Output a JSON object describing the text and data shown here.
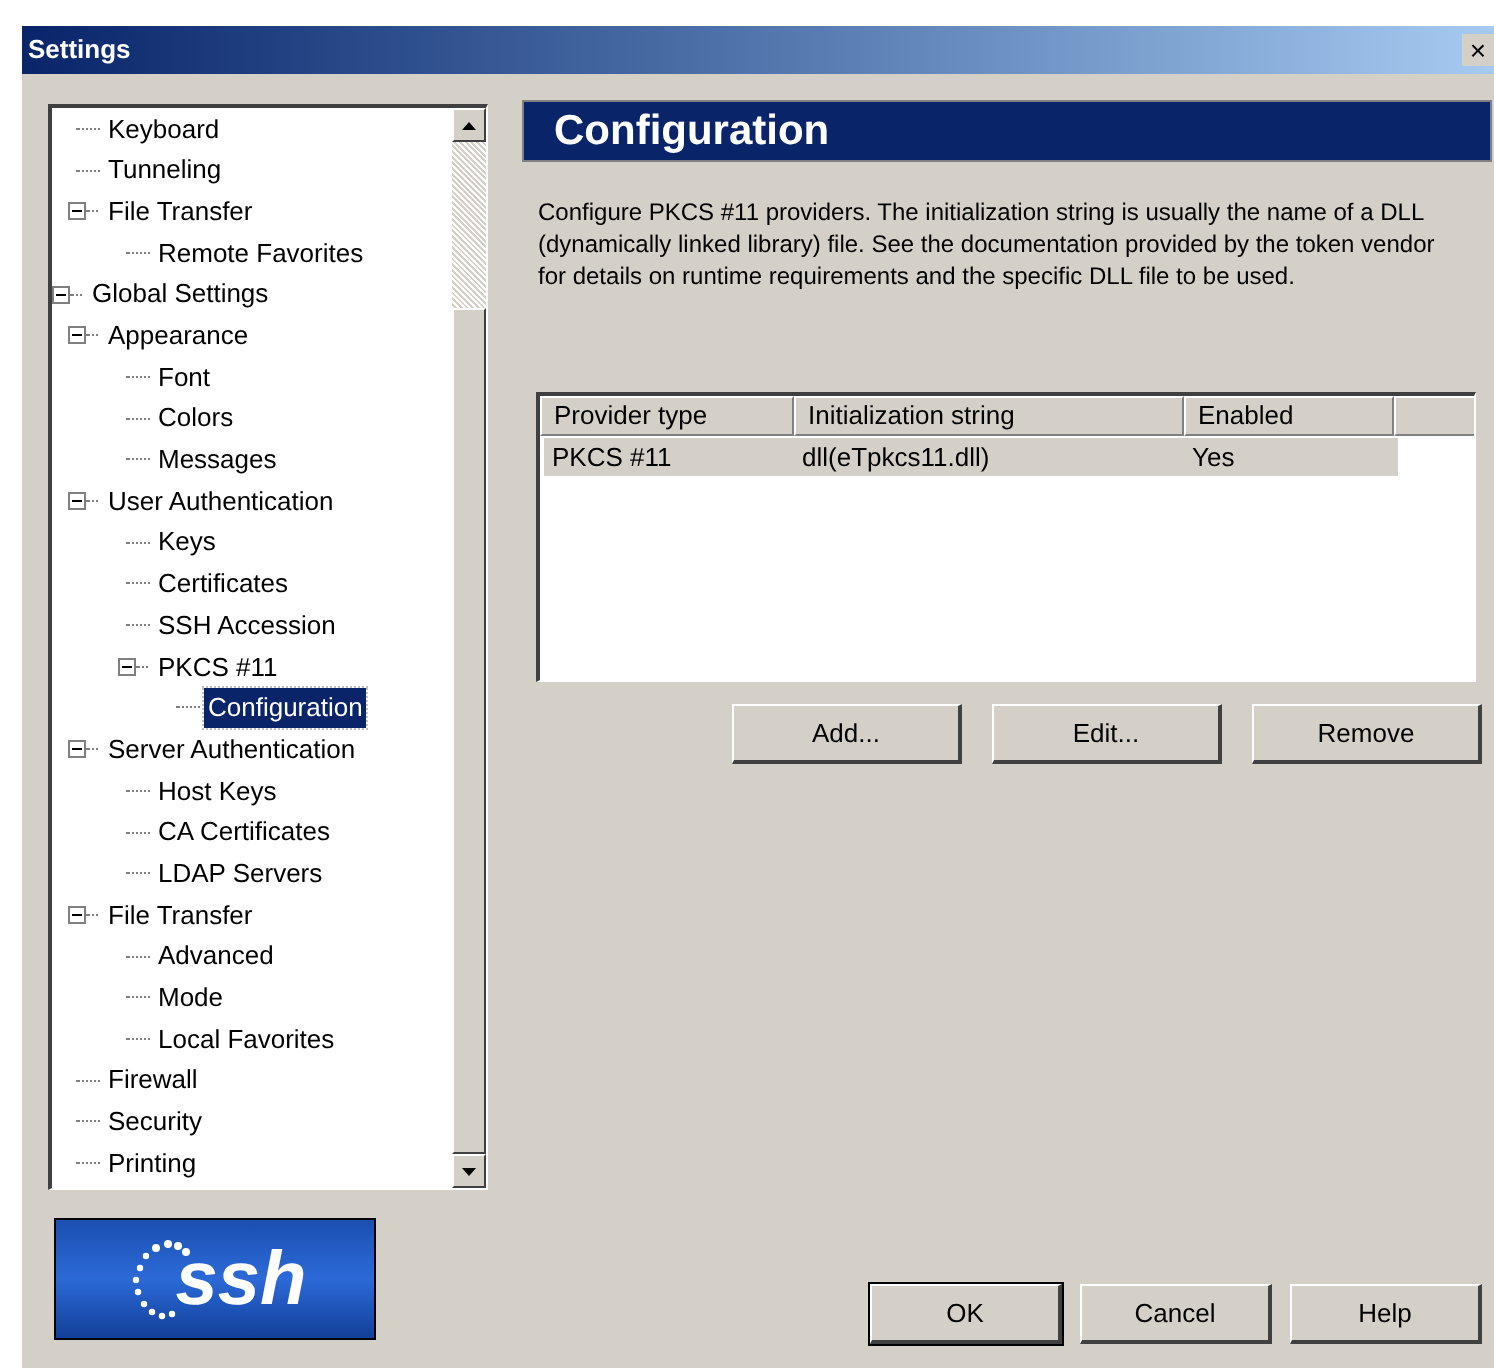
{
  "window": {
    "title": "Settings",
    "close": "×"
  },
  "tree": {
    "items": [
      {
        "children": [
          {
            "label": "Keyboard",
            "selected": false
          },
          {
            "label": "Tunneling",
            "selected": false
          },
          {
            "label": "File Transfer",
            "selected": false,
            "expanded": true,
            "children": [
              {
                "label": "Remote Favorites",
                "selected": false
              }
            ]
          }
        ]
      },
      {
        "label": "Global Settings",
        "selected": false,
        "expanded": true,
        "children": [
          {
            "label": "Appearance",
            "selected": false,
            "expanded": true,
            "children": [
              {
                "label": "Font",
                "selected": false
              },
              {
                "label": "Colors",
                "selected": false
              },
              {
                "label": "Messages",
                "selected": false
              }
            ]
          },
          {
            "label": "User Authentication",
            "selected": false,
            "expanded": true,
            "children": [
              {
                "label": "Keys",
                "selected": false
              },
              {
                "label": "Certificates",
                "selected": false
              },
              {
                "label": "SSH Accession",
                "selected": false
              },
              {
                "label": "PKCS #11",
                "selected": false,
                "expanded": true,
                "children": [
                  {
                    "label": "Configuration",
                    "selected": true
                  }
                ]
              }
            ]
          },
          {
            "label": "Server Authentication",
            "selected": false,
            "expanded": true,
            "children": [
              {
                "label": "Host Keys",
                "selected": false
              },
              {
                "label": "CA Certificates",
                "selected": false
              },
              {
                "label": "LDAP Servers",
                "selected": false
              }
            ]
          },
          {
            "label": "File Transfer",
            "selected": false,
            "expanded": true,
            "children": [
              {
                "label": "Advanced",
                "selected": false
              },
              {
                "label": "Mode",
                "selected": false
              },
              {
                "label": "Local Favorites",
                "selected": false
              }
            ]
          },
          {
            "label": "Firewall",
            "selected": false
          },
          {
            "label": "Security",
            "selected": false
          },
          {
            "label": "Printing",
            "selected": false
          }
        ]
      }
    ]
  },
  "logo": {
    "text": "ssh"
  },
  "page": {
    "title": "Configuration",
    "description": "Configure PKCS #11 providers. The initialization string is usually the name of a DLL (dynamically linked library) file. See the documentation provided by the token vendor for details on runtime requirements and the specific DLL file to be used."
  },
  "table": {
    "columns": [
      "Provider type",
      "Initialization string",
      "Enabled"
    ],
    "rows": [
      {
        "cells": [
          "PKCS #11",
          "dll(eTpkcs11.dll)",
          "Yes"
        ],
        "selected": true
      }
    ]
  },
  "table_buttons": [
    "Add...",
    "Edit...",
    "Remove"
  ],
  "dialog_buttons": [
    {
      "label": "OK",
      "default": true
    },
    {
      "label": "Cancel",
      "default": false
    },
    {
      "label": "Help",
      "default": false
    }
  ]
}
